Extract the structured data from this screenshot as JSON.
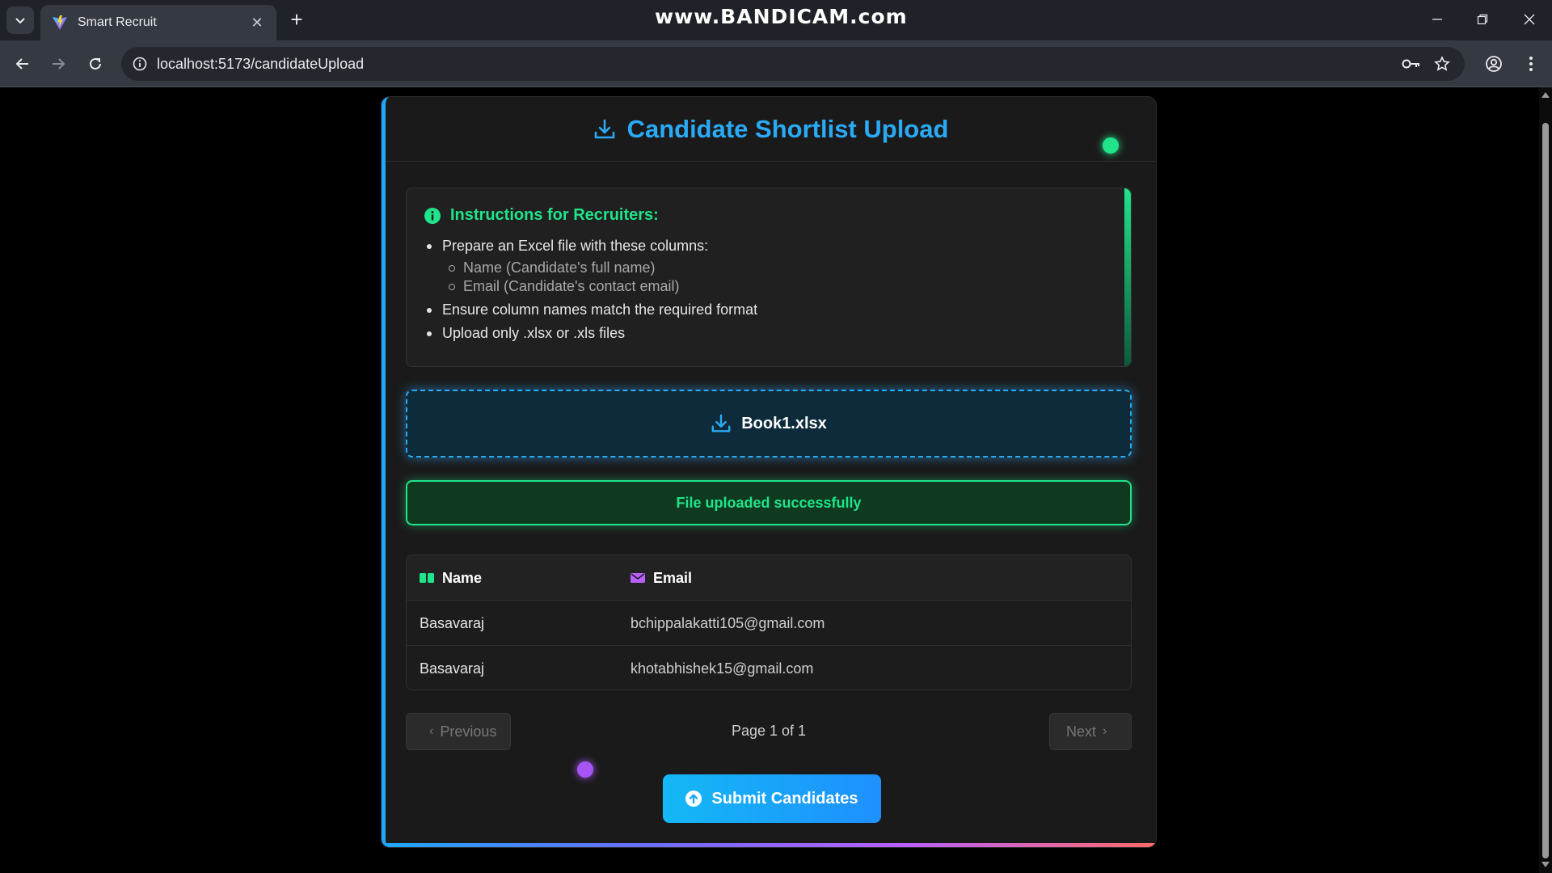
{
  "browser": {
    "tab_title": "Smart Recruit",
    "url": "localhost:5173/candidateUpload",
    "watermark": "www.BANDICAM.com"
  },
  "page": {
    "title": "Candidate Shortlist Upload",
    "instructions": {
      "title": "Instructions for Recruiters:",
      "items": [
        "Prepare an Excel file with these columns:",
        "Ensure column names match the required format",
        "Upload only .xlsx or .xls files"
      ],
      "sub_items": [
        "Name (Candidate's full name)",
        "Email (Candidate's contact email)"
      ]
    },
    "upload": {
      "file_name": "Book1.xlsx"
    },
    "status_message": "File uploaded successfully",
    "table": {
      "headers": [
        "Name",
        "Email"
      ],
      "rows": [
        [
          "Basavaraj",
          "bchippalakatti105@gmail.com"
        ],
        [
          "Basavaraj",
          "khotabhishek15@gmail.com"
        ]
      ]
    },
    "pagination": {
      "previous_label": "Previous",
      "next_label": "Next",
      "page_info": "Page 1 of 1"
    },
    "submit_label": "Submit Candidates"
  },
  "colors": {
    "accent_blue": "#2aaaf5",
    "accent_green": "#20e38a",
    "accent_purple": "#a855f7"
  }
}
